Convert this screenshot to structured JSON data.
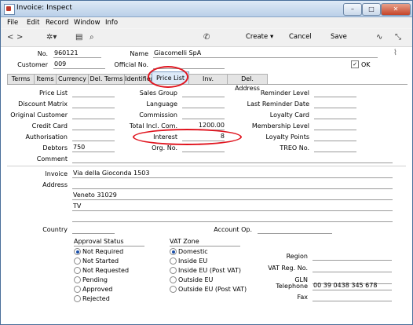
{
  "window": {
    "title": "Invoice: Inspect",
    "controls": [
      "–",
      "□",
      "✕"
    ]
  },
  "menu": [
    "File",
    "Edit",
    "Record",
    "Window",
    "Info"
  ],
  "toolbar": {
    "create": "Create",
    "cancel": "Cancel",
    "save": "Save"
  },
  "header": {
    "no_label": "No.",
    "no_value": "960121",
    "name_label": "Name",
    "name_value": "Giacomelli SpA",
    "customer_label": "Customer",
    "customer_value": "009",
    "official_label": "Official No.",
    "official_value": "",
    "ok_label": "OK",
    "ok_checked": true
  },
  "tabs": [
    "Terms",
    "Items",
    "Currency",
    "Del. Terms",
    "Identifiers",
    "Price List",
    "Inv. Address",
    "Del. Address"
  ],
  "active_tab": "Price List",
  "col1": [
    {
      "label": "Price List",
      "value": ""
    },
    {
      "label": "Discount Matrix",
      "value": ""
    },
    {
      "label": "Original Customer",
      "value": ""
    },
    {
      "label": "Credit Card",
      "value": ""
    },
    {
      "label": "Authorisation",
      "value": ""
    },
    {
      "label": "Debtors",
      "value": "750"
    },
    {
      "label": "Comment",
      "value": ""
    }
  ],
  "col2": [
    {
      "label": "Sales Group",
      "value": ""
    },
    {
      "label": "Language",
      "value": ""
    },
    {
      "label": "Commission",
      "value": ""
    },
    {
      "label": "Total Incl. Com.",
      "value": "1200.00"
    },
    {
      "label": "Interest",
      "value": "8"
    },
    {
      "label": "Org. No.",
      "value": ""
    }
  ],
  "col3": [
    {
      "label": "Reminder Level",
      "value": ""
    },
    {
      "label": "Last Reminder Date",
      "value": ""
    },
    {
      "label": "Loyalty Card",
      "value": ""
    },
    {
      "label": "Membership Level",
      "value": ""
    },
    {
      "label": "Loyalty Points",
      "value": ""
    },
    {
      "label": "TREO No.",
      "value": ""
    }
  ],
  "address": {
    "invoice_label": "Invoice",
    "address_label": "Address",
    "lines": [
      "Via della Gioconda 1503",
      "",
      "Veneto 31029",
      "TV",
      ""
    ],
    "country_label": "Country",
    "country_value": "",
    "account_label": "Account Op.",
    "account_value": ""
  },
  "approval": {
    "title": "Approval Status",
    "options": [
      "Not Required",
      "Not Started",
      "Not Requested",
      "Pending",
      "Approved",
      "Rejected"
    ],
    "selected": 0
  },
  "vat": {
    "title": "VAT Zone",
    "options": [
      "Domestic",
      "Inside EU",
      "Inside EU (Post VAT)",
      "Outside EU",
      "Outside EU (Post VAT)"
    ],
    "selected": 0
  },
  "right_fields": [
    {
      "label": "Region",
      "value": ""
    },
    {
      "label": "VAT Reg. No.",
      "value": ""
    },
    {
      "label": "GLN",
      "value": ""
    },
    {
      "label": "Telephone",
      "value": "00 39 0438 345 678"
    },
    {
      "label": "Fax",
      "value": ""
    }
  ],
  "colors": {
    "highlight": "#e0141e",
    "active_tab": "#ddeaf8"
  }
}
